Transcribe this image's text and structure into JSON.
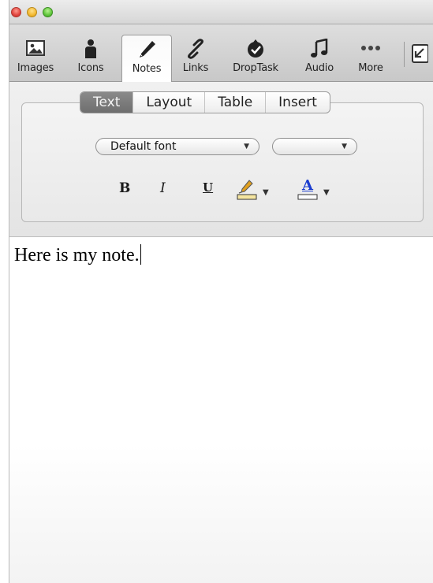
{
  "toolbar": {
    "items": [
      {
        "label": "Images",
        "icon": "image-icon"
      },
      {
        "label": "Icons",
        "icon": "person-icon"
      },
      {
        "label": "Notes",
        "icon": "pencil-icon",
        "active": true
      },
      {
        "label": "Links",
        "icon": "link-icon"
      },
      {
        "label": "DropTask",
        "icon": "droptask-icon"
      },
      {
        "label": "Audio",
        "icon": "music-note-icon"
      },
      {
        "label": "More",
        "icon": "more-dots-icon"
      }
    ]
  },
  "format": {
    "tabs": [
      {
        "label": "Text",
        "active": true
      },
      {
        "label": "Layout"
      },
      {
        "label": "Table"
      },
      {
        "label": "Insert"
      }
    ],
    "font_select": {
      "value": "Default font"
    },
    "size_select": {
      "value": ""
    },
    "bold_label": "B",
    "italic_label": "I",
    "underline_label": "U",
    "text_color_label": "A"
  },
  "editor": {
    "content": "Here is my note."
  },
  "colors": {
    "highlight_bar": "#f5e5a0",
    "text_color_underline": "#1a3ccf",
    "pencil": "#e0a020"
  }
}
